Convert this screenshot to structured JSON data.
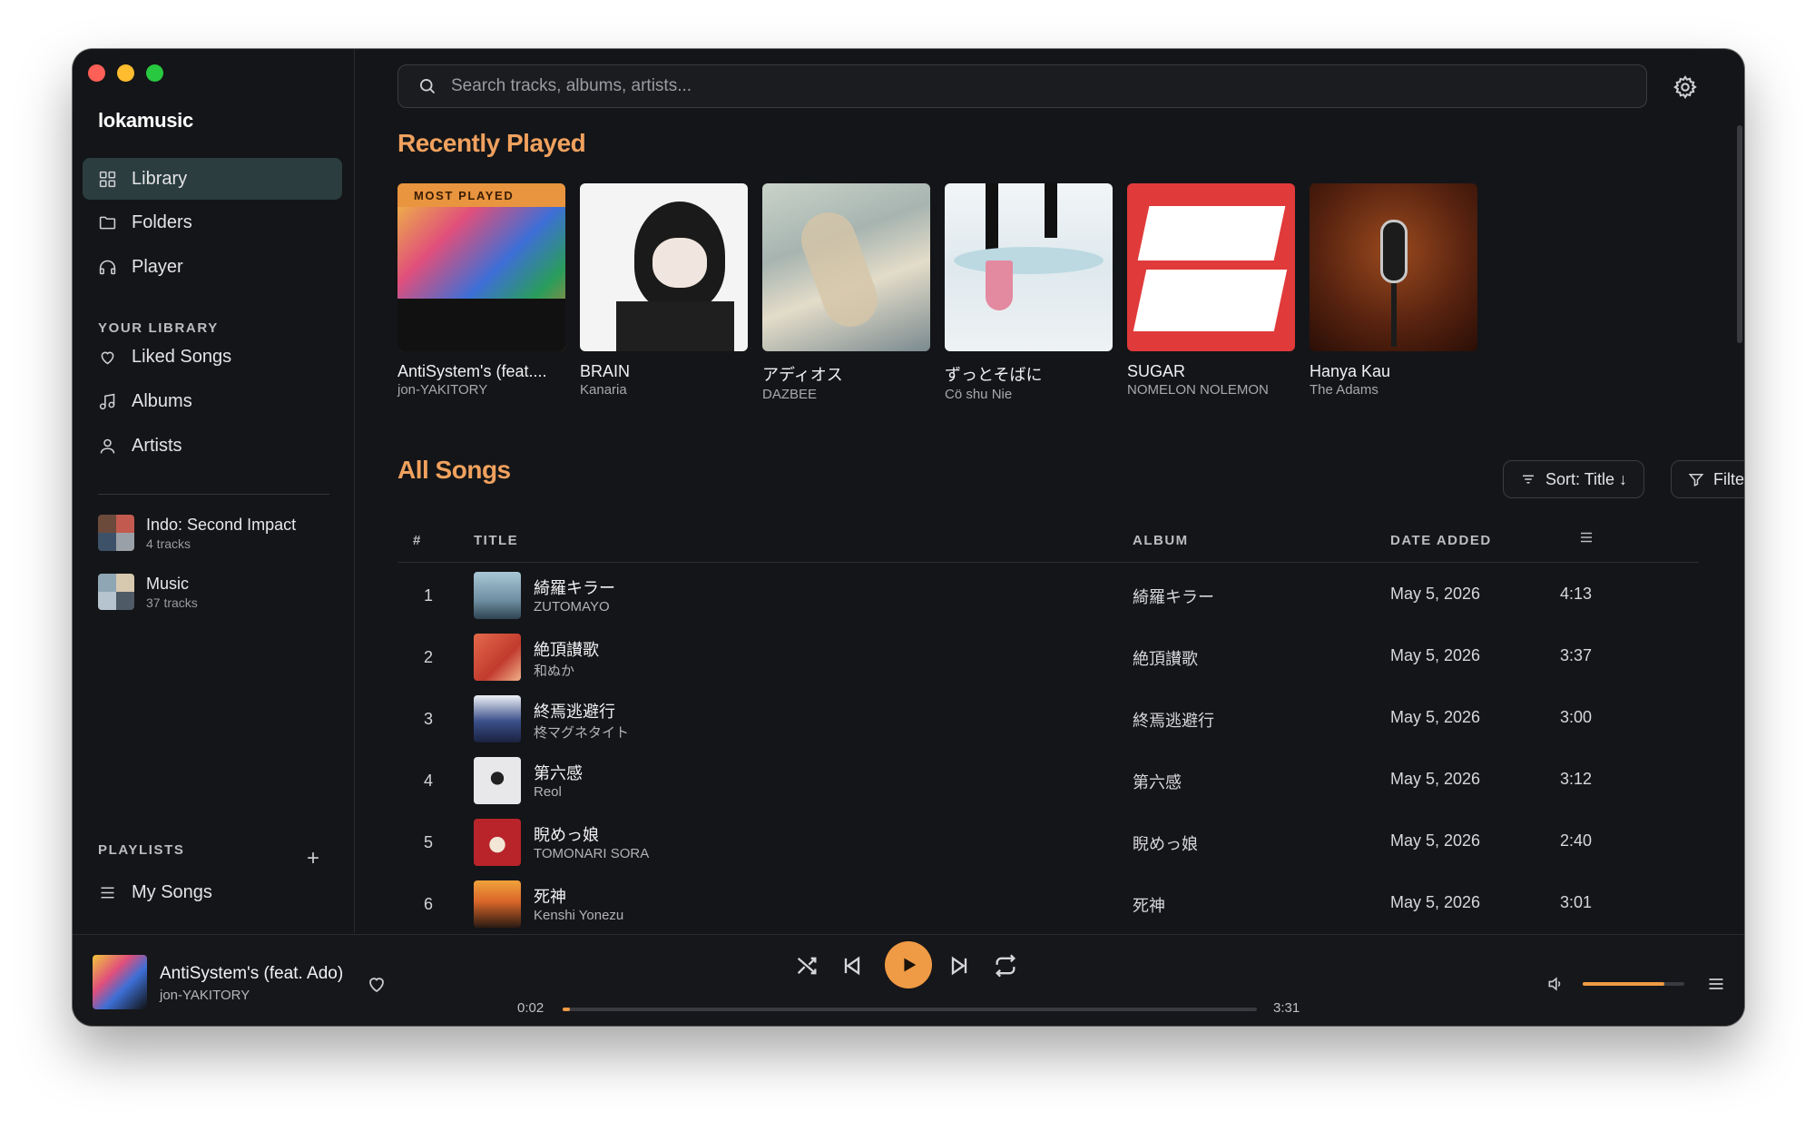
{
  "app": {
    "name": "lokamusic"
  },
  "nav": [
    {
      "label": "Library",
      "icon": "grid-icon",
      "active": true
    },
    {
      "label": "Folders",
      "icon": "folder-icon",
      "active": false
    },
    {
      "label": "Player",
      "icon": "headphones-icon",
      "active": false
    }
  ],
  "your_library": {
    "heading": "YOUR LIBRARY",
    "items": [
      {
        "label": "Liked Songs",
        "icon": "heart-icon"
      },
      {
        "label": "Albums",
        "icon": "music-note-icon"
      },
      {
        "label": "Artists",
        "icon": "user-icon"
      }
    ],
    "collections": [
      {
        "title": "Indo: Second Impact",
        "sub": "4 tracks"
      },
      {
        "title": "Music",
        "sub": "37 tracks"
      }
    ]
  },
  "playlists": {
    "heading": "PLAYLISTS",
    "add": "+",
    "items": [
      {
        "label": "My Songs"
      }
    ]
  },
  "search": {
    "placeholder": "Search tracks, albums, artists..."
  },
  "recently_played": {
    "heading": "Recently Played",
    "badge": "MOST PLAYED",
    "cards": [
      {
        "title": "AntiSystem's (feat....",
        "artist": "jon-YAKITORY"
      },
      {
        "title": "BRAIN",
        "artist": "Kanaria"
      },
      {
        "title": "アディオス",
        "artist": "DAZBEE"
      },
      {
        "title": "ずっとそばに",
        "artist": "Cö shu Nie"
      },
      {
        "title": "SUGAR",
        "artist": "NOMELON NOLEMON"
      },
      {
        "title": "Hanya Kau",
        "artist": "The Adams"
      }
    ]
  },
  "all_songs": {
    "heading": "All Songs",
    "sort_label": "Sort: Title ↓",
    "filter_label": "Filter",
    "columns": {
      "num": "#",
      "title": "TITLE",
      "album": "ALBUM",
      "date": "DATE ADDED"
    },
    "rows": [
      {
        "num": "1",
        "title": "綺羅キラー",
        "artist": "ZUTOMAYO",
        "album": "綺羅キラー",
        "date": "May 5, 2026",
        "duration": "4:13"
      },
      {
        "num": "2",
        "title": "絶頂讃歌",
        "artist": "和ぬか",
        "album": "絶頂讃歌",
        "date": "May 5, 2026",
        "duration": "3:37"
      },
      {
        "num": "3",
        "title": "終焉逃避行",
        "artist": "柊マグネタイト",
        "album": "終焉逃避行",
        "date": "May 5, 2026",
        "duration": "3:00"
      },
      {
        "num": "4",
        "title": "第六感",
        "artist": "Reol",
        "album": "第六感",
        "date": "May 5, 2026",
        "duration": "3:12"
      },
      {
        "num": "5",
        "title": "睨めっ娘",
        "artist": "TOMONARI SORA",
        "album": "睨めっ娘",
        "date": "May 5, 2026",
        "duration": "2:40"
      },
      {
        "num": "6",
        "title": "死神",
        "artist": "Kenshi Yonezu",
        "album": "死神",
        "date": "May 5, 2026",
        "duration": "3:01"
      }
    ]
  },
  "player": {
    "title": "AntiSystem's (feat. Ado)",
    "artist": "jon-YAKITORY",
    "elapsed": "0:02",
    "total": "3:31",
    "progress": 0.01,
    "volume": 0.8
  },
  "colors": {
    "accent": "#ef9a44",
    "heading": "#f0a15e",
    "active_nav": "#2b3d3f",
    "background": "#141518"
  }
}
